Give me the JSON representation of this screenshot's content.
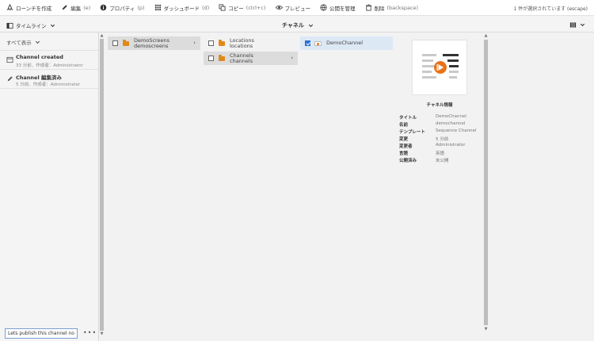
{
  "toolbar": {
    "actions": [
      {
        "label": "ローンチを作成",
        "key": ""
      },
      {
        "label": "編集",
        "key": "(e)"
      },
      {
        "label": "プロパティ",
        "key": "(p)"
      },
      {
        "label": "ダッシュボード",
        "key": "(d)"
      },
      {
        "label": "コピー",
        "key": "(ctrl+c)"
      },
      {
        "label": "プレビュー",
        "key": ""
      },
      {
        "label": "公開を管理",
        "key": ""
      },
      {
        "label": "削除",
        "key": "(backspace)"
      }
    ],
    "selection_status": "1 件が選択されています (escape)"
  },
  "subbar": {
    "rail_label": "タイムライン",
    "view_title": "チャネル"
  },
  "rail": {
    "filter_label": "すべて表示",
    "items": [
      {
        "title": "Channel created",
        "meta": "33 分前、作成者：Administrator"
      },
      {
        "title": "Channel 編集済み",
        "meta": "5 分前、作成者：Administrator"
      }
    ],
    "comment_value": "Lets publish this channel now",
    "more_label": "•••"
  },
  "columns": {
    "col1": [
      {
        "title": "DemoScreens",
        "name": "demoscreens"
      }
    ],
    "col2": [
      {
        "title": "Locations",
        "name": "locations"
      },
      {
        "title": "Channels",
        "name": "channels"
      }
    ],
    "col3": [
      {
        "title": "DemoChannel"
      }
    ]
  },
  "info": {
    "heading": "チャネル情報",
    "rows": [
      {
        "k": "タイトル",
        "v": "DemoChannel"
      },
      {
        "k": "名前",
        "v": "demochannel"
      },
      {
        "k": "テンプレート",
        "v": "Sequence Channel"
      },
      {
        "k": "変更",
        "v": "5 分前"
      },
      {
        "k": "変更者",
        "v": "Administrator"
      },
      {
        "k": "言語",
        "v": "英語"
      },
      {
        "k": "公開済み",
        "v": "未公開"
      }
    ]
  },
  "colors": {
    "accent": "#2d6fd6",
    "folder": "#e0891b",
    "play": "#e8731a"
  }
}
